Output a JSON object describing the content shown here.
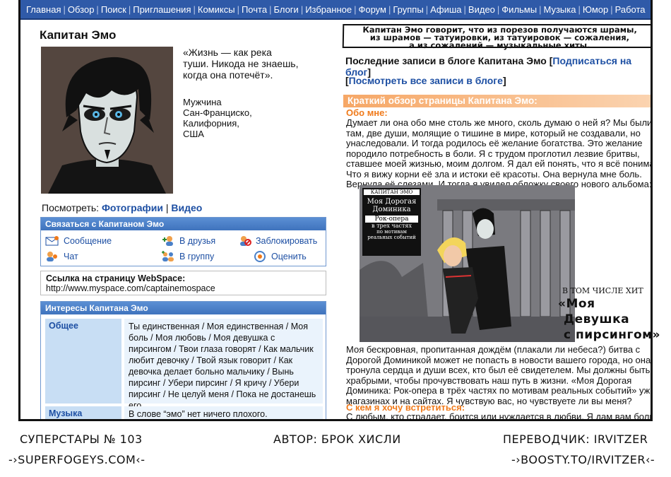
{
  "nav": [
    "Главная",
    "Обзор",
    "Поиск",
    "Приглашения",
    "Комиксы",
    "Почта",
    "Блоги",
    "Избранное",
    "Форум",
    "Группы",
    "Афиша",
    "Видео",
    "Фильмы",
    "Музыка",
    "Юмор",
    "Работа"
  ],
  "profile": {
    "name": "Капитан Эмо",
    "quote": "«Жизнь — как река туши. Никода не знаешь, когда она потечёт».",
    "gender": "Мужчина",
    "city": "Сан-Франциско,",
    "state": "Калифорния,",
    "country": "США",
    "view_label": "Посмотреть:",
    "photos": "Фотографии",
    "separator": "|",
    "videos": "Видео"
  },
  "contact": {
    "title": "Связаться с Капитаном Эмо",
    "message": "Сообщение",
    "add_friend": "В друзья",
    "block": "Заблокировать",
    "chat": "Чат",
    "to_group": "В группу",
    "rate": "Оценить"
  },
  "webspace": {
    "label": "Ссылка на страницу WebSpace:",
    "url": "http://www.myspace.com/captainemospace"
  },
  "interests": {
    "title": "Интересы Капитана Эмо",
    "general_label": "Общее",
    "general_value": "Ты единственная / Моя единственная / Моя  боль / Моя любовь / Моя девушка с пирсингом / Твои глаза говорят / Как мальчик любит девочку / Твой язык говорит / Как девочка делает больно мальчику / Вынь пирсинг / Убери пирсинг / Я кричу / Убери пирсинг / Не целуй меня / Пока не достанешь его",
    "music_label": "Музыка",
    "music_value": "В слове “эмо” нет ничего плохого."
  },
  "caption": {
    "line1": "Капитан Эмо говорит, что из порезов получаются шрамы,",
    "line2": "из шрамов — татуировки, из татуировок — сожаления,",
    "line3": "а из сожалений — музыкальные хиты."
  },
  "blog": {
    "latest_prefix": "Последние записи в блоге Капитана Эмо",
    "subscribe": "Подписаться на блог",
    "view_all": "Посмотреть все записи в блоге",
    "overview": "Краткий обзор страницы Капитана Эмо:",
    "about_heading": "Обо мне:",
    "about_text": "Думает ли она обо мне столь же много, сколь думаю о ней я? Мы были там, две души, молящие о тишине в мире, который не создавали, но унаследовали. И тогда родилось её желание богатства. Это желание породило потребность в боли. Я с трудом проглотил лезвие бритвы, ставшее моей жизнью, моим долгом. Я дал ей понять, что я всё понимаю. Что я вижу корни её зла и истоки её красоты. Она вернула мне боль. Вернула её слезами. И тогда я увидел обложку своего нового альбома:",
    "after_text": "Моя бескровная, пропитанная дождём (плакали ли небеса?) битва с Дорогой Доминикой может не попасть в новости вашего города, но она тронула сердца и души всех, кто был её свидетелем. Мы должны быть храбрыми, чтобы прочувствовать наш путь в жизни. «Моя Дорогая Доминика: Рок-опера в трёх частях по мотивам реальных событий» уже в магазинах и на сайтах. Я чувствую вас, но чувствуете ли вы меня?",
    "meet_heading": "С кем я хочу встретиться:",
    "meet_text": "С любым, кто страдает, боится или нуждается в любви. Я дам вам боль и"
  },
  "album": {
    "artist": "КАПИТАН ЭМО",
    "title1": "Моя Дорогая",
    "title2": "Доминика",
    "sub1": "Рок-опера",
    "sub2": "в трех частях",
    "sub3": "по мотивам",
    "sub4": "реальных событий",
    "hit_label": "В ТОМ ЧИСЛЕ ХИТ",
    "hit1": "«Моя",
    "hit2": "Девушка",
    "hit3": "с пирсингом»"
  },
  "footer": {
    "left_title": "СУПЕРСТАРЫ № 103",
    "left_site": "-›SUPERFOGEYS.COM‹-",
    "center": "АВТОР: БРОК ХИСЛИ",
    "right_title": "ПЕРЕВОДЧИК: IRVITZER",
    "right_site": "-›BOOSTY.TO/IRVITZER‹-"
  },
  "colors": {
    "nav_bg": "#2f5aa8",
    "link_blue": "#1d4fa3",
    "orange": "#f07a1a",
    "box_head": "#4a80c8"
  }
}
